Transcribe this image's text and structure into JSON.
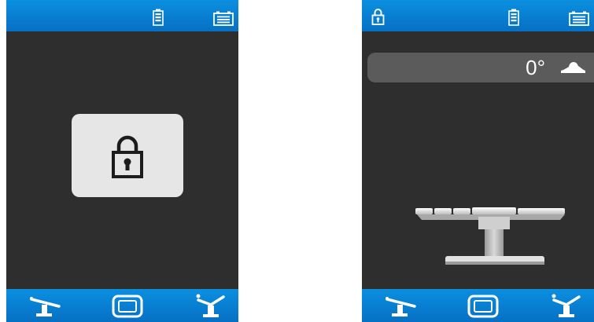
{
  "left_panel": {
    "top_bar": {
      "icons": [
        "battery-icon",
        "mains-power-icon"
      ]
    },
    "center": {
      "icon": "padlock-icon",
      "state": "locked"
    },
    "bottom_bar": {
      "icons": [
        "table-flat-icon",
        "screen-mode-icon",
        "table-beach-chair-icon"
      ]
    }
  },
  "right_panel": {
    "top_bar": {
      "icons": [
        "padlock-icon",
        "battery-icon",
        "mains-power-icon"
      ]
    },
    "angle": {
      "value": "0°",
      "icon": "tilt-indicator-icon"
    },
    "table_graphic": {
      "icon": "operating-table-icon"
    },
    "bottom_bar": {
      "icons": [
        "table-flat-icon",
        "screen-mode-icon",
        "table-beach-chair-icon"
      ]
    }
  },
  "colors": {
    "bar_blue": "#0670c4",
    "screen_bg": "#2e2e2e",
    "tile_bg": "#e6e6e6",
    "angle_bar_bg": "#5b5b5b"
  }
}
